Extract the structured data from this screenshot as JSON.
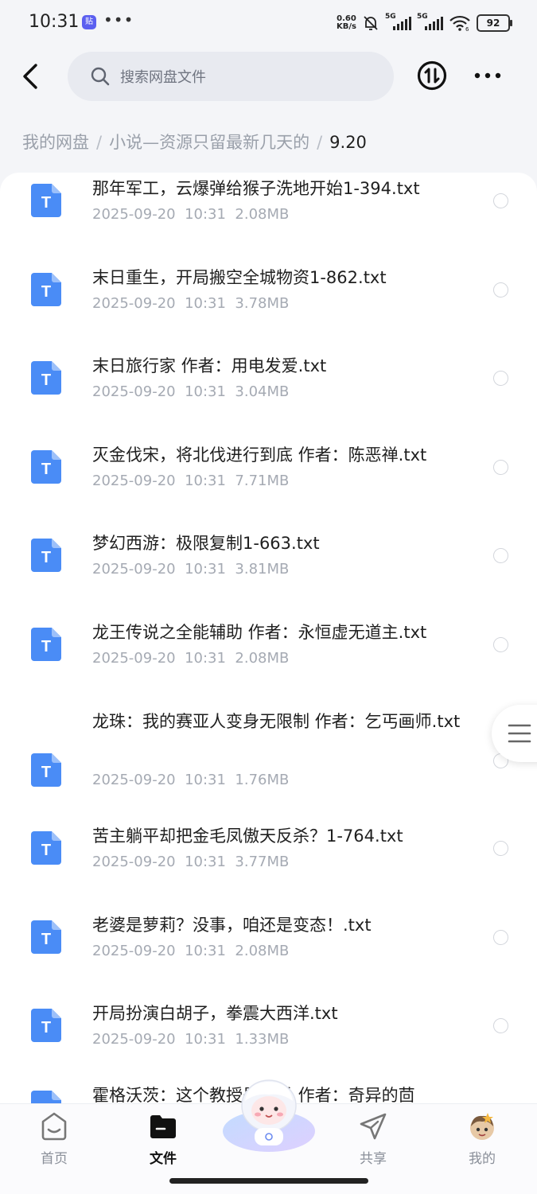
{
  "status_bar": {
    "time": "10:31",
    "app_badge": "贴",
    "net_speed_value": "0.60",
    "net_speed_unit": "KB/s",
    "signal_1": "5G",
    "signal_2": "5G",
    "wifi_label": "6",
    "battery": "92"
  },
  "header": {
    "search_placeholder": "搜索网盘文件"
  },
  "breadcrumb": {
    "items": [
      "我的网盘",
      "小说—资源只留最新几天的",
      "9.20"
    ],
    "separator": "/"
  },
  "files": [
    {
      "name": "那年军工，云爆弹给猴子洗地开始1-394.txt",
      "date": "2025-09-20",
      "time": "10:31",
      "size": "2.08MB"
    },
    {
      "name": "末日重生，开局搬空全城物资1-862.txt",
      "date": "2025-09-20",
      "time": "10:31",
      "size": "3.78MB"
    },
    {
      "name": "末日旅行家 作者：用电发爱.txt",
      "date": "2025-09-20",
      "time": "10:31",
      "size": "3.04MB"
    },
    {
      "name": "灭金伐宋，将北伐进行到底 作者：陈恶禅.txt",
      "date": "2025-09-20",
      "time": "10:31",
      "size": "7.71MB"
    },
    {
      "name": "梦幻西游：极限复制1-663.txt",
      "date": "2025-09-20",
      "time": "10:31",
      "size": "3.81MB"
    },
    {
      "name": "龙王传说之全能辅助 作者：永恒虚无道主.txt",
      "date": "2025-09-20",
      "time": "10:31",
      "size": "2.08MB"
    },
    {
      "name": "龙珠：我的赛亚人变身无限制 作者：乞丐画师.txt",
      "date": "2025-09-20",
      "time": "10:31",
      "size": "1.76MB"
    },
    {
      "name": "苦主躺平却把金毛凤傲天反杀？1-764.txt",
      "date": "2025-09-20",
      "time": "10:31",
      "size": "3.77MB"
    },
    {
      "name": "老婆是萝莉？没事，咱还是变态！.txt",
      "date": "2025-09-20",
      "time": "10:31",
      "size": "2.08MB"
    },
    {
      "name": "开局扮演白胡子，拳震大西洋.txt",
      "date": "2025-09-20",
      "time": "10:31",
      "size": "1.33MB"
    },
    {
      "name": "霍格沃茨：这个教授是麻瓜 作者：奇异的茴",
      "date": "",
      "time": "",
      "size": ""
    }
  ],
  "file_icon_letter": "T",
  "bottom_nav": {
    "home": "首页",
    "files": "文件",
    "share": "共享",
    "mine": "我的"
  },
  "colors": {
    "accent": "#3b7cf5",
    "file_icon": "#4a8cf6",
    "text_primary": "#1f1f1f",
    "text_secondary": "#a5aab3"
  }
}
